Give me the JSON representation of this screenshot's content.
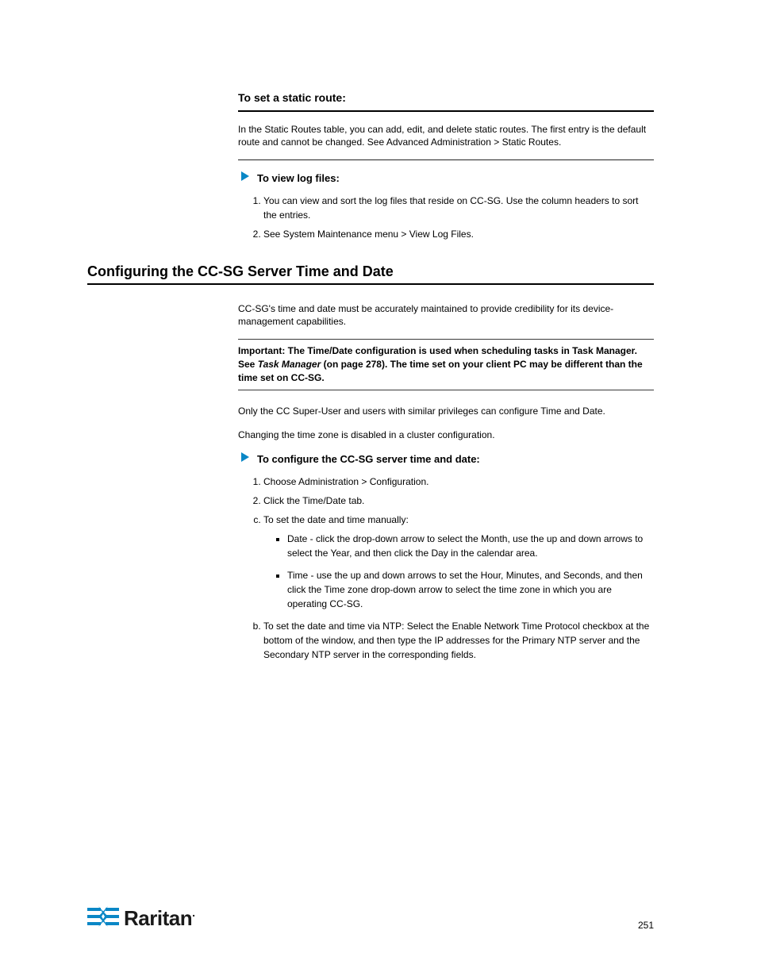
{
  "subsection": {
    "title": "To set a static route:",
    "intro": "In the Static Routes table, you can add, edit, and delete static routes. The first entry is the default route and cannot be changed. See Advanced Administration > Static Routes.",
    "proc_label": "To view log files:",
    "steps": [
      "You can view and sort the log files that reside on CC-SG. Use the column headers to sort the entries.",
      "See System Maintenance menu > View Log Files."
    ]
  },
  "section": {
    "heading": "Configuring the CC-SG Server Time and Date",
    "intro1": "CC-SG's time and date must be accurately maintained to provide credibility for its device-management capabilities.",
    "important": {
      "prefix": "Important: The Time/Date configuration is used when scheduling tasks in Task Manager. See ",
      "italic": "Task Manager",
      "suffix": " (on page 278). The time set on your client PC may be different than the time set on CC-SG."
    },
    "note1": "Only the CC Super-User and users with similar privileges can configure Time and Date.",
    "note2": "Changing the time zone is disabled in a cluster configuration.",
    "proc_label": "To configure the CC-SG server time and date:",
    "steps_top": [
      "Choose Administration > Configuration.",
      "Click the Time/Date tab."
    ],
    "steps_a_label": "To set the date and time manually:",
    "steps_a_items": [
      "Date - click the drop-down arrow to select the Month, use the up and down arrows to select the Year, and then click the Day in the calendar area.",
      "Time - use the up and down arrows to set the Hour, Minutes, and Seconds, and then click the Time zone drop-down arrow to select the time zone in which you are operating CC-SG."
    ],
    "steps_b_label": "To set the date and time via NTP: Select the Enable Network Time Protocol checkbox at the bottom of the window, and then type the IP addresses for the Primary NTP server and the Secondary NTP server in the corresponding fields."
  },
  "pageNumber": "251"
}
